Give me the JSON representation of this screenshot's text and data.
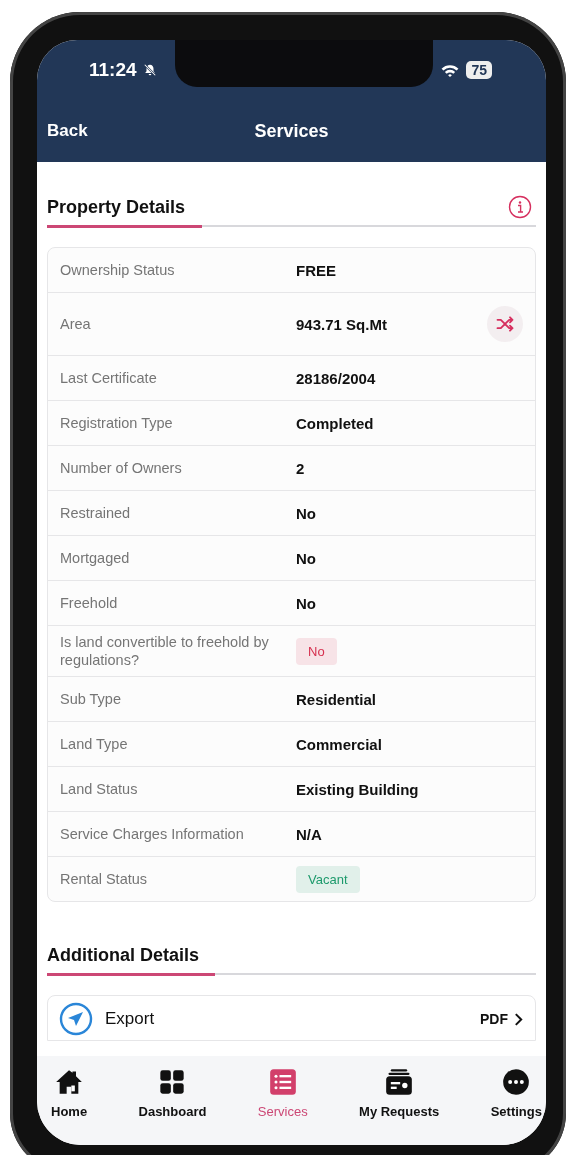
{
  "status_bar": {
    "time": "11:24",
    "battery": "75"
  },
  "nav_bar": {
    "back": "Back",
    "title": "Services"
  },
  "property_details": {
    "title": "Property Details",
    "rows": [
      {
        "label": "Ownership Status",
        "value": "FREE",
        "kind": "text"
      },
      {
        "label": "Area",
        "value": "943.71 Sq.Mt",
        "kind": "text_action"
      },
      {
        "label": "Last Certificate",
        "value": "28186/2004",
        "kind": "text"
      },
      {
        "label": "Registration Type",
        "value": "Completed",
        "kind": "text"
      },
      {
        "label": "Number of Owners",
        "value": "2",
        "kind": "text"
      },
      {
        "label": "Restrained",
        "value": "No",
        "kind": "text"
      },
      {
        "label": "Mortgaged",
        "value": "No",
        "kind": "text"
      },
      {
        "label": "Freehold",
        "value": "No",
        "kind": "text"
      },
      {
        "label": "Is land convertible to freehold by regulations?",
        "value": "No",
        "kind": "badge",
        "color": "#d6304f"
      },
      {
        "label": "Sub Type",
        "value": "Residential",
        "kind": "text"
      },
      {
        "label": "Land Type",
        "value": "Commercial",
        "kind": "text"
      },
      {
        "label": "Land Status",
        "value": "Existing Building",
        "kind": "text"
      },
      {
        "label": "Service Charges Information",
        "value": "N/A",
        "kind": "text"
      },
      {
        "label": "Rental Status",
        "value": "Vacant",
        "kind": "badge",
        "color": "#1d9a6c"
      }
    ]
  },
  "additional_details": {
    "title": "Additional Details",
    "export": {
      "label": "Export",
      "format": "PDF"
    }
  },
  "tab_bar": [
    {
      "label": "Home",
      "selected": false
    },
    {
      "label": "Dashboard",
      "selected": false
    },
    {
      "label": "Services",
      "selected": true
    },
    {
      "label": "My Requests",
      "selected": false
    },
    {
      "label": "Settings",
      "selected": false
    }
  ]
}
